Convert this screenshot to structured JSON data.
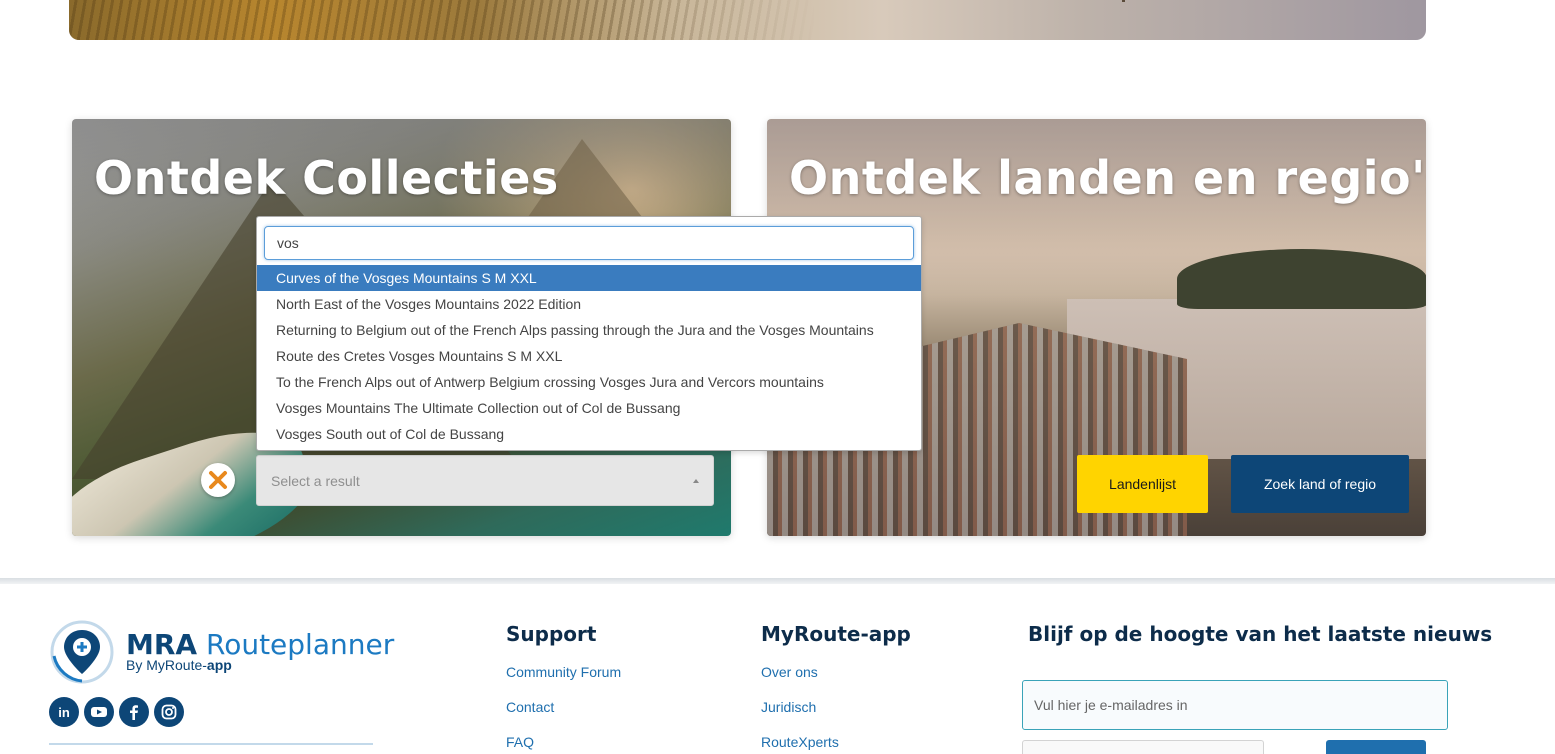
{
  "collections_card": {
    "title": "Ontdek Collecties",
    "select_placeholder": "Select a result"
  },
  "dropdown": {
    "search_value": "vos",
    "results": [
      "Curves of the Vosges Mountains S M XXL",
      "North East of the Vosges Mountains 2022 Edition",
      "Returning to Belgium out of the French Alps passing through the Jura and the Vosges Mountains",
      "Route des Cretes Vosges Mountains S M XXL",
      "To the French Alps out of Antwerp Belgium crossing Vosges Jura and Vercors mountains",
      "Vosges Mountains The Ultimate Collection out of Col de Bussang",
      "Vosges South out of Col de Bussang"
    ],
    "highlighted_index": 0
  },
  "countries_card": {
    "title": "Ontdek landen en regio's",
    "country_list_button": "Landenlijst",
    "search_region_button": "Zoek land of regio"
  },
  "footer": {
    "logo": {
      "name_bold": "MRA",
      "name_light": "Routeplanner",
      "sub_prefix": "By MyRoute-",
      "sub_bold": "app"
    },
    "socials": [
      "linkedin-icon",
      "youtube-icon",
      "facebook-icon",
      "instagram-icon"
    ],
    "support": {
      "heading": "Support",
      "links": [
        "Community Forum",
        "Contact",
        "FAQ"
      ]
    },
    "myroute": {
      "heading": "MyRoute-app",
      "links": [
        "Over ons",
        "Juridisch",
        "RouteXperts"
      ]
    },
    "newsletter": {
      "heading": "Blijf op de hoogte van het laatste nieuws",
      "email_placeholder": "Vul hier je e-mailadres in"
    }
  },
  "colors": {
    "brand_blue": "#0d4677",
    "link_blue": "#1f6fae",
    "highlight_blue": "#3a7cbf",
    "accent_yellow": "#ffd400",
    "clear_orange": "#e8891d"
  }
}
